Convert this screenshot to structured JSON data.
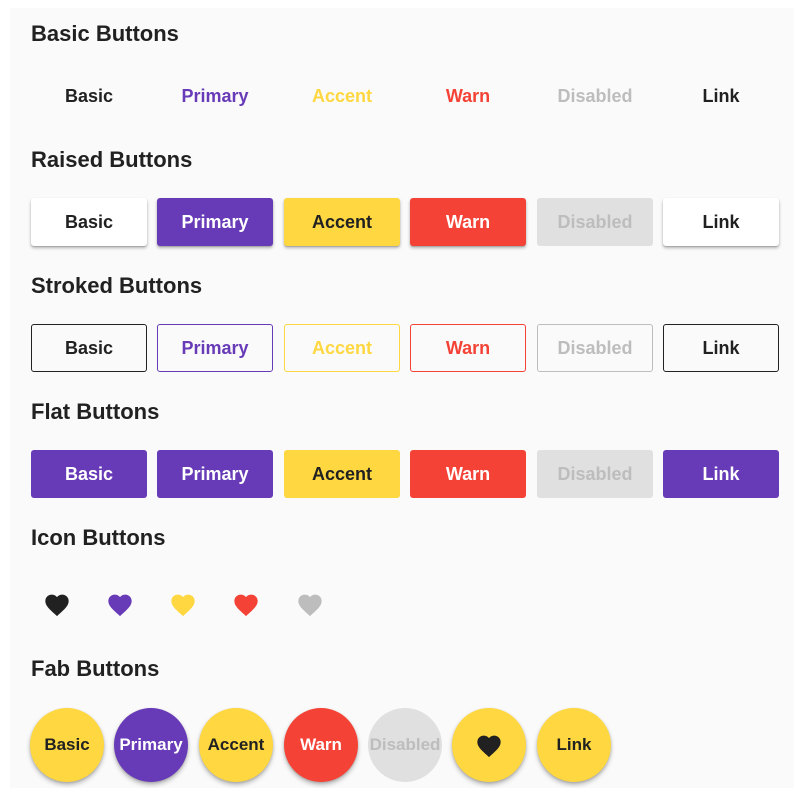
{
  "colors": {
    "basic": "#212121",
    "primary": "#673ab7",
    "accent": "#ffd740",
    "warn": "#f44336",
    "disabled": "#bdbdbd",
    "disabled_bg": "#e0e0e0",
    "white": "#ffffff"
  },
  "basic_section": {
    "title": "Basic Buttons",
    "buttons": [
      "Basic",
      "Primary",
      "Accent",
      "Warn",
      "Disabled",
      "Link"
    ]
  },
  "raised_section": {
    "title": "Raised Buttons",
    "buttons": [
      "Basic",
      "Primary",
      "Accent",
      "Warn",
      "Disabled",
      "Link"
    ]
  },
  "stroked_section": {
    "title": "Stroked Buttons",
    "buttons": [
      "Basic",
      "Primary",
      "Accent",
      "Warn",
      "Disabled",
      "Link"
    ]
  },
  "flat_section": {
    "title": "Flat Buttons",
    "buttons": [
      "Basic",
      "Primary",
      "Accent",
      "Warn",
      "Disabled",
      "Link"
    ]
  },
  "icon_section": {
    "title": "Icon Buttons",
    "icons": [
      "heart-icon",
      "heart-icon",
      "heart-icon",
      "heart-icon",
      "heart-icon"
    ]
  },
  "fab_section": {
    "title": "Fab Buttons",
    "buttons": [
      "Basic",
      "Primary",
      "Accent",
      "Warn",
      "Disabled",
      "",
      "Link"
    ],
    "icon": "heart-icon"
  }
}
